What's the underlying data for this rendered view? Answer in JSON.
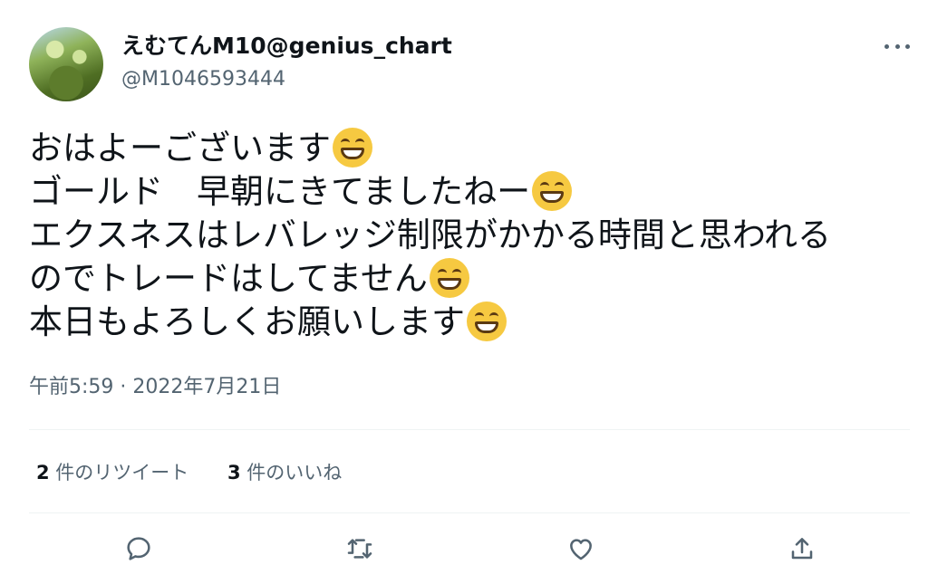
{
  "author": {
    "display_name": "えむてんM10@genius_chart",
    "handle": "@M1046593444",
    "avatar": "avatar"
  },
  "menu": {
    "more_icon": "more-icon"
  },
  "tweet": {
    "lines": [
      "おはよーございます",
      "ゴールド　早朝にきてましたねー",
      "エクスネスはレバレッジ制限がかかる時間と思われる",
      "のでトレードはしてません",
      "本日もよろしくお願いします"
    ],
    "emoji": "grinning-face-with-smiling-eyes"
  },
  "timestamp": "午前5:59 · 2022年7月21日",
  "stats": {
    "retweets_count": "2",
    "retweets_label": " 件のリツイート",
    "likes_count": "3",
    "likes_label": " 件のいいね"
  },
  "actions": {
    "reply_icon": "reply-icon",
    "retweet_icon": "retweet-icon",
    "like_icon": "heart-icon",
    "share_icon": "share-icon"
  },
  "colors": {
    "text": "#0f1419",
    "secondary": "#536471",
    "divider": "#eff3f4",
    "emoji": "#f6c941"
  }
}
